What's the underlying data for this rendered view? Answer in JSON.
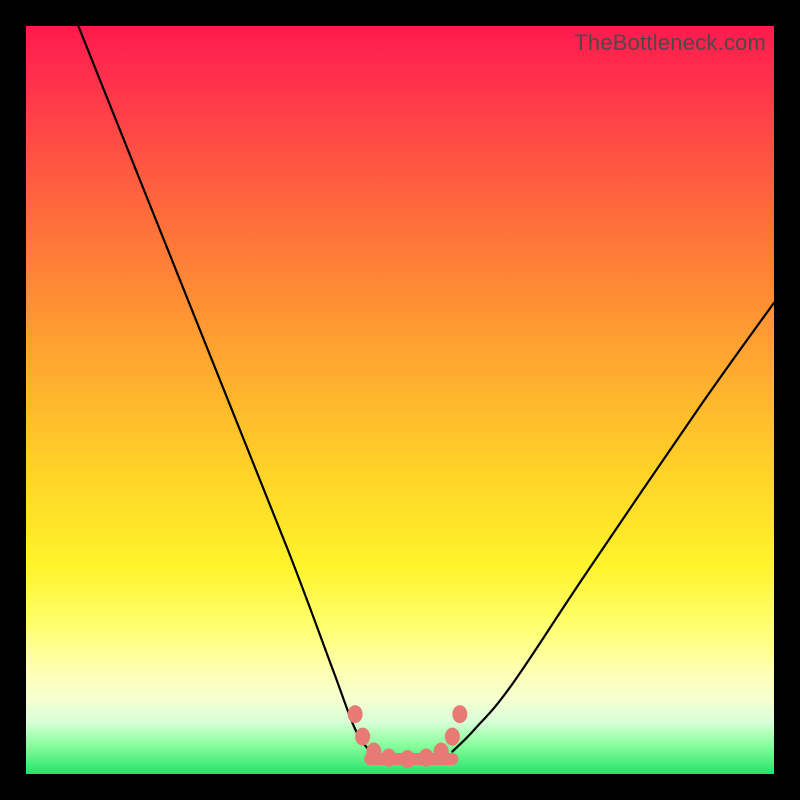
{
  "attribution": "TheBottleneck.com",
  "colors": {
    "frame": "#000000",
    "curve": "#000000",
    "marker": "#e77a74"
  },
  "chart_data": {
    "type": "line",
    "title": "",
    "xlabel": "",
    "ylabel": "",
    "xlim": [
      0,
      100
    ],
    "ylim": [
      0,
      100
    ],
    "grid": false,
    "legend": false,
    "series": [
      {
        "name": "bottleneck-curve-left",
        "x": [
          7,
          15,
          25,
          35,
          41,
          44,
          46
        ],
        "values": [
          100,
          80,
          55,
          30,
          14,
          6,
          3
        ]
      },
      {
        "name": "bottleneck-curve-right",
        "x": [
          57,
          60,
          65,
          75,
          90,
          100
        ],
        "values": [
          3,
          6,
          12,
          27,
          49,
          63
        ]
      },
      {
        "name": "bottom-flat",
        "x": [
          46,
          57
        ],
        "values": [
          2,
          2
        ]
      }
    ],
    "markers": {
      "name": "highlight-dots",
      "x": [
        44.0,
        45.0,
        46.5,
        48.5,
        51.0,
        53.5,
        55.5,
        57.0,
        58.0
      ],
      "values": [
        8.0,
        5.0,
        3.0,
        2.2,
        2.0,
        2.2,
        3.0,
        5.0,
        8.0
      ]
    }
  }
}
